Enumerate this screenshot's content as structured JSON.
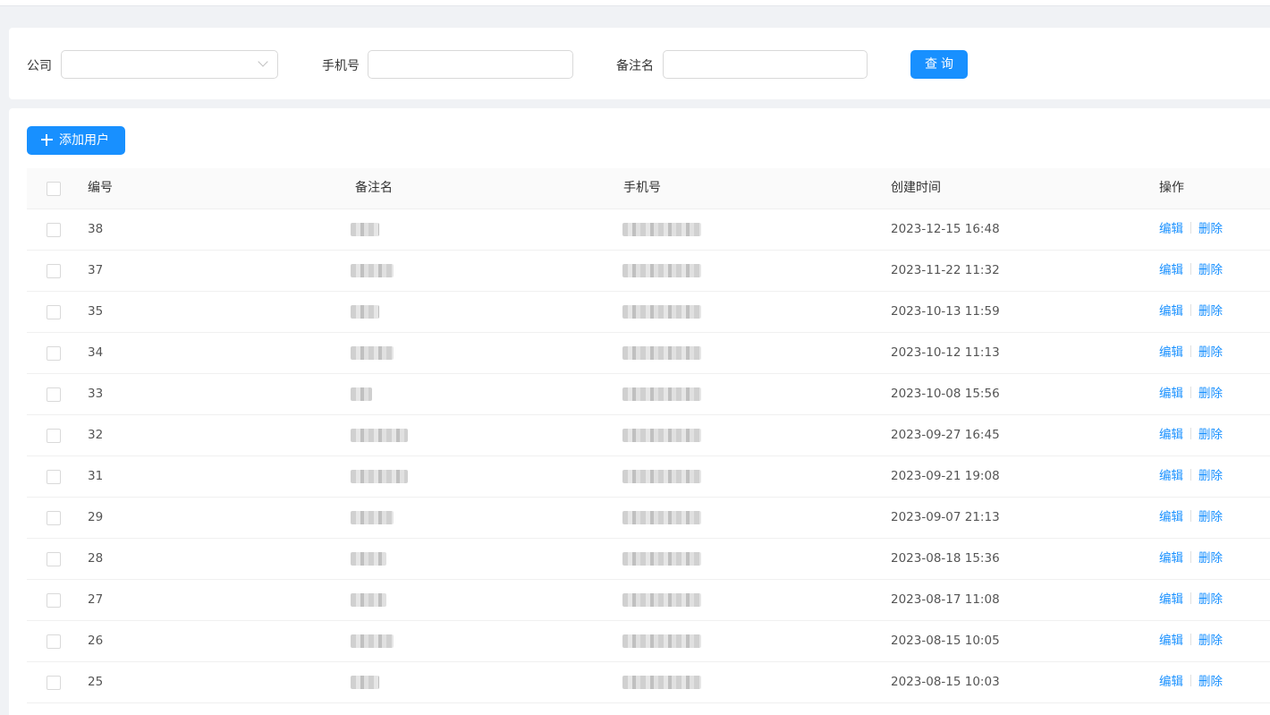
{
  "filters": {
    "company_label": "公司",
    "company_value": "",
    "phone_label": "手机号",
    "phone_value": "",
    "note_label": "备注名",
    "note_value": "",
    "query_label": "查询"
  },
  "toolbar": {
    "add_user_label": "添加用户"
  },
  "table": {
    "columns": [
      "编号",
      "备注名",
      "手机号",
      "创建时间",
      "操作"
    ],
    "edit_label": "编辑",
    "delete_label": "删除",
    "rows": [
      {
        "id": "38",
        "created": "2023-12-15 16:48"
      },
      {
        "id": "37",
        "created": "2023-11-22 11:32"
      },
      {
        "id": "35",
        "created": "2023-10-13 11:59"
      },
      {
        "id": "34",
        "created": "2023-10-12 11:13"
      },
      {
        "id": "33",
        "created": "2023-10-08 15:56"
      },
      {
        "id": "32",
        "created": "2023-09-27 16:45"
      },
      {
        "id": "31",
        "created": "2023-09-21 19:08"
      },
      {
        "id": "29",
        "created": "2023-09-07 21:13"
      },
      {
        "id": "28",
        "created": "2023-08-18 15:36"
      },
      {
        "id": "27",
        "created": "2023-08-17 11:08"
      },
      {
        "id": "26",
        "created": "2023-08-15 10:05"
      },
      {
        "id": "25",
        "created": "2023-08-15 10:03"
      }
    ]
  },
  "colors": {
    "accent": "#1890ff",
    "background": "#f0f2f5"
  }
}
